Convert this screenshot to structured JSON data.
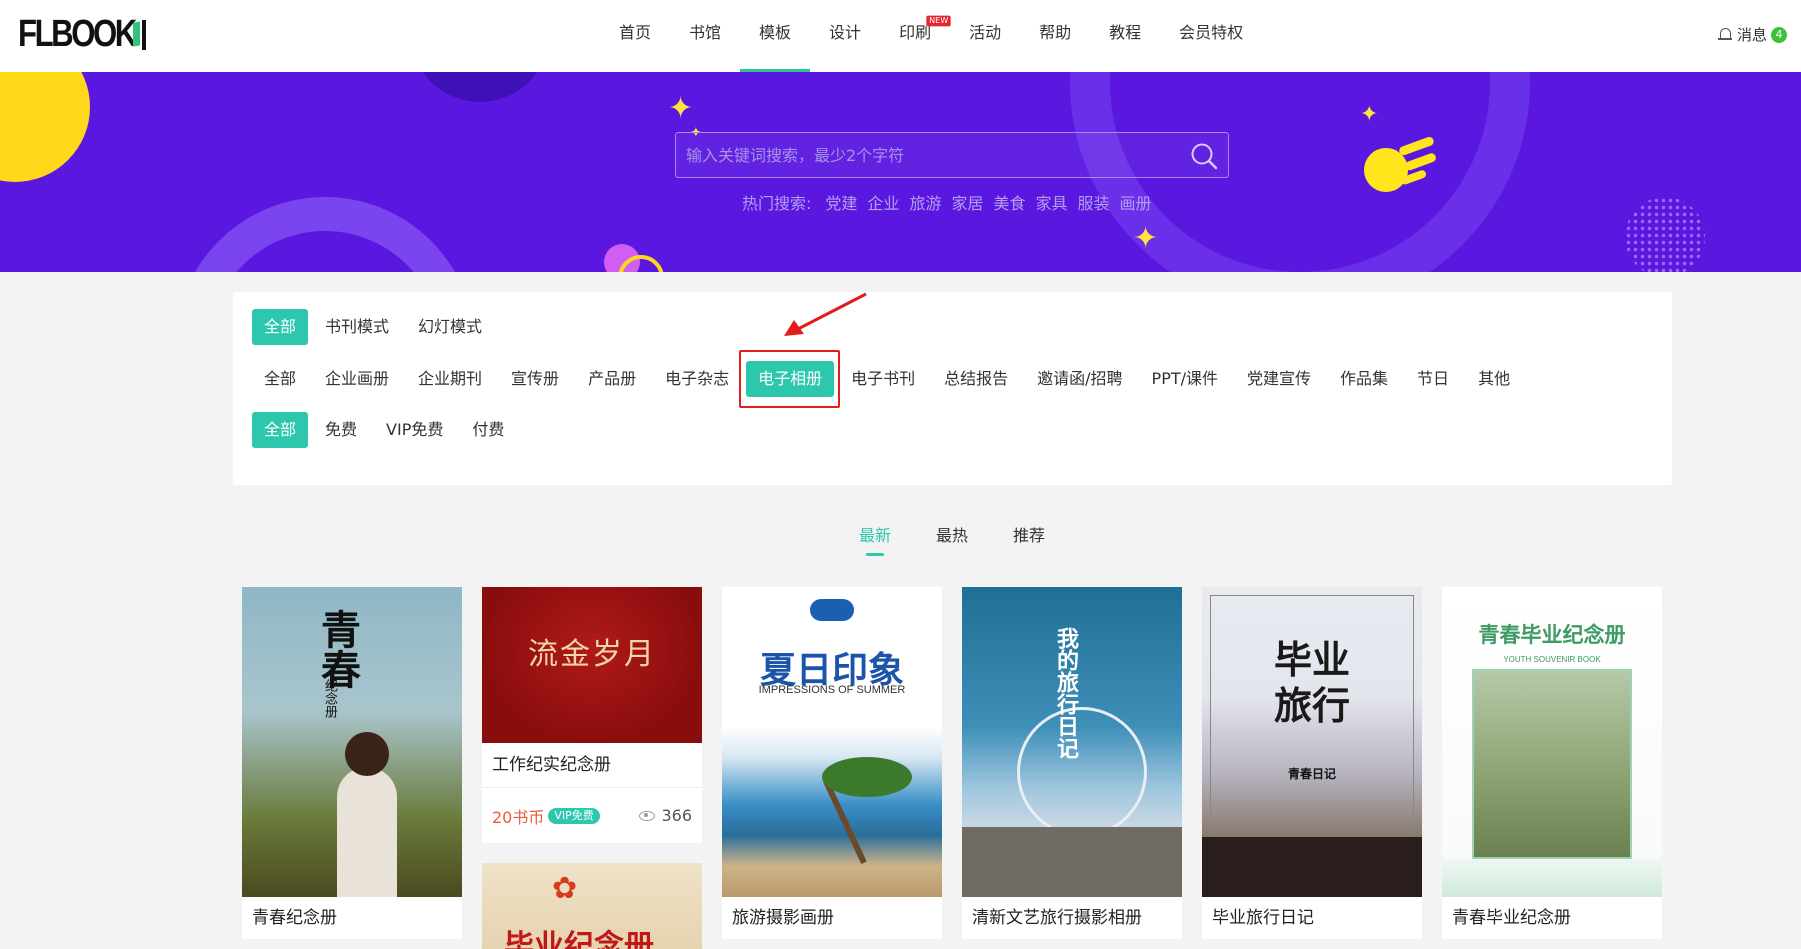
{
  "header": {
    "logo": "FLBOOK",
    "nav": [
      {
        "label": "首页"
      },
      {
        "label": "书馆"
      },
      {
        "label": "模板",
        "active": true
      },
      {
        "label": "设计"
      },
      {
        "label": "印刷",
        "badge": "NEW"
      },
      {
        "label": "活动"
      },
      {
        "label": "帮助"
      },
      {
        "label": "教程"
      },
      {
        "label": "会员特权"
      }
    ],
    "message_label": "消息",
    "message_count": "4"
  },
  "banner": {
    "search_placeholder": "输入关键词搜索，最少2个字符",
    "hot_label": "热门搜索:",
    "hot_terms": [
      "党建",
      "企业",
      "旅游",
      "家居",
      "美食",
      "家具",
      "服装",
      "画册"
    ]
  },
  "filters": {
    "mode": [
      "全部",
      "书刊模式",
      "幻灯模式"
    ],
    "category": [
      "全部",
      "企业画册",
      "企业期刊",
      "宣传册",
      "产品册",
      "电子杂志",
      "电子相册",
      "电子书刊",
      "总结报告",
      "邀请函/招聘",
      "PPT/课件",
      "党建宣传",
      "作品集",
      "节日",
      "其他"
    ],
    "price": [
      "全部",
      "免费",
      "VIP免费",
      "付费"
    ],
    "selected_mode": "全部",
    "selected_category": "电子相册",
    "selected_price": "全部"
  },
  "sort_tabs": [
    "最新",
    "最热",
    "推荐"
  ],
  "cards": [
    {
      "title": "青春纪念册",
      "cover_text": "青春",
      "cover_sub": "纪念册"
    },
    {
      "title": "工作纪实纪念册",
      "cover_text": "流金岁月",
      "price": "20书币",
      "vip": "VIP免费",
      "views": "366"
    },
    {
      "title": "旅游摄影画册",
      "cover_text": "夏日印象",
      "cover_sub": "IMPRESSIONS OF SUMMER"
    },
    {
      "title": "清新文艺旅行摄影相册",
      "cover_text": "我的旅行日记"
    },
    {
      "title": "毕业旅行日记",
      "cover_text": "毕业旅行",
      "cover_sub": "青春日记"
    },
    {
      "title": "青春毕业纪念册",
      "cover_text": "青春毕业纪念册",
      "cover_sub": "YOUTH SOUVENIR BOOK"
    },
    {
      "title": "",
      "cover_text": "毕业纪念册"
    }
  ],
  "colors": {
    "accent": "#2dc7ad",
    "banner": "#5a17e0",
    "highlight": "#e31b1b",
    "price": "#ee5a3a"
  }
}
